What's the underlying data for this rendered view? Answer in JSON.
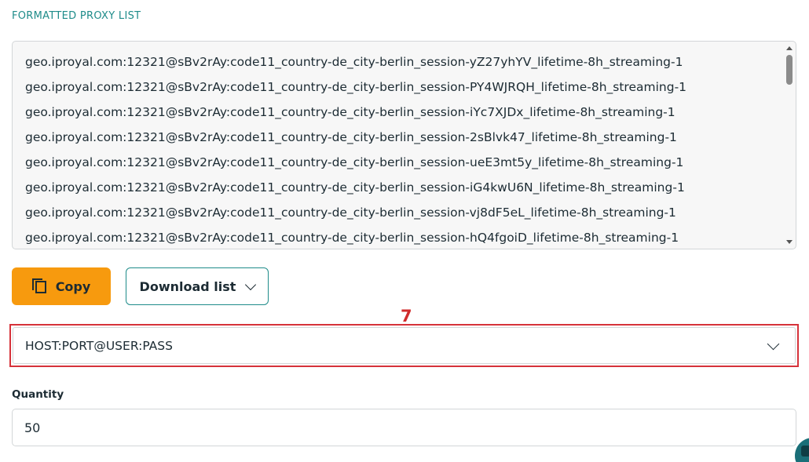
{
  "section": {
    "label": "FORMATTED PROXY LIST"
  },
  "proxy_list": {
    "lines": [
      "geo.iproyal.com:12321@sBv2rAy:code11_country-de_city-berlin_session-yZ27yhYV_lifetime-8h_streaming-1",
      "geo.iproyal.com:12321@sBv2rAy:code11_country-de_city-berlin_session-PY4WJRQH_lifetime-8h_streaming-1",
      "geo.iproyal.com:12321@sBv2rAy:code11_country-de_city-berlin_session-iYc7XJDx_lifetime-8h_streaming-1",
      "geo.iproyal.com:12321@sBv2rAy:code11_country-de_city-berlin_session-2sBlvk47_lifetime-8h_streaming-1",
      "geo.iproyal.com:12321@sBv2rAy:code11_country-de_city-berlin_session-ueE3mt5y_lifetime-8h_streaming-1",
      "geo.iproyal.com:12321@sBv2rAy:code11_country-de_city-berlin_session-iG4kwU6N_lifetime-8h_streaming-1",
      "geo.iproyal.com:12321@sBv2rAy:code11_country-de_city-berlin_session-vj8dF5eL_lifetime-8h_streaming-1",
      "geo.iproyal.com:12321@sBv2rAy:code11_country-de_city-berlin_session-hQ4fgoiD_lifetime-8h_streaming-1"
    ]
  },
  "actions": {
    "copy_label": "Copy",
    "copy_icon": "copy-icon",
    "download_label": "Download list",
    "download_icon": "chevron-down-icon"
  },
  "annotation": {
    "number": "7",
    "color": "#d6323a"
  },
  "format_select": {
    "value": "HOST:PORT@USER:PASS"
  },
  "quantity": {
    "label": "Quantity",
    "value": "50"
  },
  "colors": {
    "accent": "#1f8c8a",
    "copy_button": "#f79a0e",
    "chat_widget": "#1a6f78"
  }
}
